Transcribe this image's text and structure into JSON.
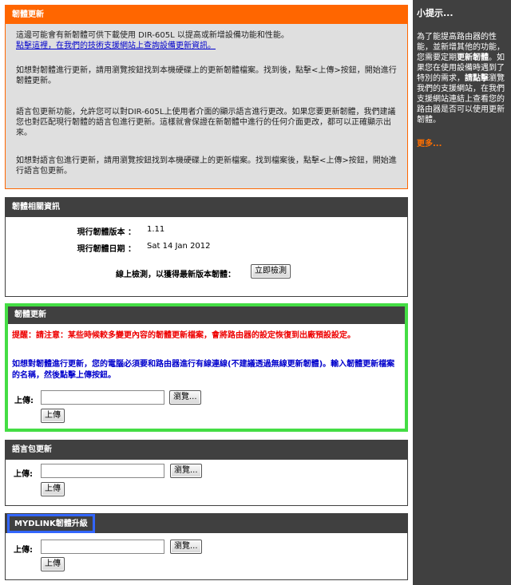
{
  "notice": {
    "title": "韌體更新",
    "para1": "這邊可能會有新韌體可供下載使用 DIR-605L 以提高或新增設備功能和性能。",
    "para1_link": "點擊這裡，在我們的技術支援網站上查詢設備更新資訊。",
    "para2": "如想對韌體進行更新，請用瀏覽按鈕找到本機硬碟上的更新韌體檔案。找到後，點擊<上傳>按鈕，開始進行韌體更新。",
    "para3": "語言包更新功能，允許您可以對DIR-605L上使用者介面的顯示語言進行更改。如果您要更新韌體，我們建議您也對匹配現行韌體的語言包進行更新。這樣就會保證在新韌體中進行的任何介面更改，都可以正確顯示出來。",
    "para4": "如想對語言包進行更新，請用瀏覽按鈕找到本機硬碟上的更新檔案。找到檔案後，點擊<上傳>按鈕，開始進行語言包更新。"
  },
  "firmware_info": {
    "title": "韌體相關資訊",
    "version_label": "現行韌體版本 ：",
    "version_value": "1.11",
    "date_label": "現行韌體日期 ：",
    "date_value": "Sat 14 Jan 2012",
    "check_label": "線上檢測，以獲得最新版本韌體：",
    "check_button": "立即檢測"
  },
  "firmware_upgrade": {
    "title": "韌體更新",
    "warning": "提醒：請注意：某些時候較多變更內容的韌體更新檔案，會將路由器的設定恢復到出廠預設設定。",
    "note": "如想對韌體進行更新，您的電腦必須要和路由器進行有線連線(不建議透過無線更新韌體)。輸入韌體更新檔案的名稱，然後點擊上傳按鈕。",
    "upload_label": "上傳:",
    "browse_button": "瀏覽...",
    "upload_button": "上傳"
  },
  "language_pack": {
    "title": "語言包更新",
    "upload_label": "上傳:",
    "browse_button": "瀏覽...",
    "upload_button": "上傳"
  },
  "mydlink": {
    "title": "MYDLINK韌體升級",
    "upload_label": "上傳:",
    "browse_button": "瀏覽...",
    "upload_button": "上傳"
  },
  "sidebar": {
    "title": "小提示...",
    "tip_pre": "為了能提高路由器的性能，並新增其他的功能，您需要定期",
    "tip_bold1": "更新韌體",
    "tip_mid": "。如果您在使用設備時遇到了特別的需求，",
    "tip_bold2": "請點擊",
    "tip_post": "瀏覽我們的支援網站，在我們支援網站連結上查看您的路由器是否可以使用更新韌體。",
    "more_link": "更多..."
  },
  "colors": {
    "notice_header": "#ff6600",
    "highlight_green": "#44dd44",
    "highlight_blue": "#3366ff",
    "warning_text": "#ee0000",
    "note_text": "#0000cc"
  }
}
